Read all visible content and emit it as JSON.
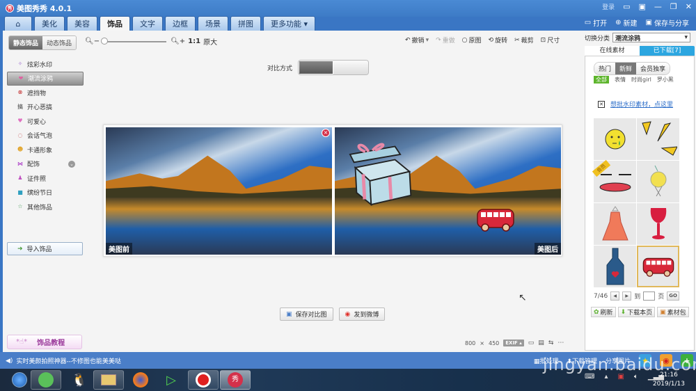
{
  "app": {
    "title": "美图秀秀 4.0.1",
    "login": "登录",
    "logo_text": "秀"
  },
  "tabs": [
    {
      "label": "⌂",
      "name": "home"
    },
    {
      "label": "美化",
      "name": "beautify"
    },
    {
      "label": "美容",
      "name": "cosmetic"
    },
    {
      "label": "饰品",
      "name": "accessories",
      "active": true
    },
    {
      "label": "文字",
      "name": "text"
    },
    {
      "label": "边框",
      "name": "frame"
    },
    {
      "label": "场景",
      "name": "scene"
    },
    {
      "label": "拼图",
      "name": "collage"
    },
    {
      "label": "更多功能 ▾",
      "name": "more"
    }
  ],
  "top_actions": {
    "open": "打开",
    "new": "新建",
    "save_share": "保存与分享"
  },
  "sidebar": {
    "seg_static": "静态饰品",
    "seg_dynamic": "动态饰品",
    "categories": [
      {
        "label": "炫彩水印",
        "icon": "✧",
        "color": "#a070d0"
      },
      {
        "label": "潮流涂鸦",
        "icon": "❤",
        "color": "#e060a0",
        "active": true
      },
      {
        "label": "遮挡物",
        "icon": "⊗",
        "color": "#c02020"
      },
      {
        "label": "开心恶搞",
        "icon": "搞",
        "color": "#333333"
      },
      {
        "label": "可爱心",
        "icon": "♥",
        "color": "#e070c0"
      },
      {
        "label": "会话气泡",
        "icon": "◌",
        "color": "#c04040"
      },
      {
        "label": "卡通形象",
        "icon": "☻",
        "color": "#e0a020"
      },
      {
        "label": "配饰",
        "icon": "⋈",
        "color": "#a020c0",
        "expand": true
      },
      {
        "label": "证件照",
        "icon": "♟",
        "color": "#c050c0"
      },
      {
        "label": "缤纷节日",
        "icon": "■",
        "color": "#30a0c0"
      },
      {
        "label": "其他饰品",
        "icon": "☆",
        "color": "#50a060"
      }
    ],
    "import_label": "导入饰品",
    "tutorial_label": "饰品教程"
  },
  "zoom": {
    "ratio_label": "1:1",
    "original_label": "原大",
    "level": 0
  },
  "toolbar": {
    "undo": "撤销",
    "redo": "重做",
    "original": "原图",
    "rotate": "旋转",
    "crop": "裁剪",
    "resize": "尺寸"
  },
  "compare": {
    "label": "对比方式",
    "mode": "side-by-side"
  },
  "photos": {
    "before_label": "美图前",
    "after_label": "美图后"
  },
  "actions": {
    "save_compare": "保存对比图",
    "post_weibo": "发到微博"
  },
  "image_info": {
    "width": "800",
    "times": "×",
    "height": "450",
    "exif": "EXIF ▴"
  },
  "right_panel": {
    "switch_label": "切换分类",
    "category_value": "潮流涂鸦",
    "tab_online": "在线素材",
    "tab_downloaded": "已下载[7]",
    "sub_tabs": [
      "热门",
      "新鲜",
      "会员独享"
    ],
    "active_sub_tab": "新鲜",
    "tags": [
      "全部",
      "表情",
      "时尚girl",
      "罗小黑"
    ],
    "active_tag": "全部",
    "batch_link": "想批水印素材，点这里",
    "vip_badge": "会员",
    "page_current": "7",
    "page_total": "46",
    "page_display": "7/46",
    "goto_label": "到",
    "page_suffix": "页",
    "go_label": "GO",
    "refresh": "刷新",
    "download_page": "下载本页",
    "material_pack": "素材包"
  },
  "statusbar": {
    "message": "实时美颜拍照神器--不修图也能美美哒",
    "batch": "批处理",
    "download_mgr": "下载管理",
    "share_image": "分享图片"
  },
  "taskbar": {
    "time": "21:16",
    "date": "2019/1/13"
  },
  "watermark": "jingyan.baidu.com"
}
